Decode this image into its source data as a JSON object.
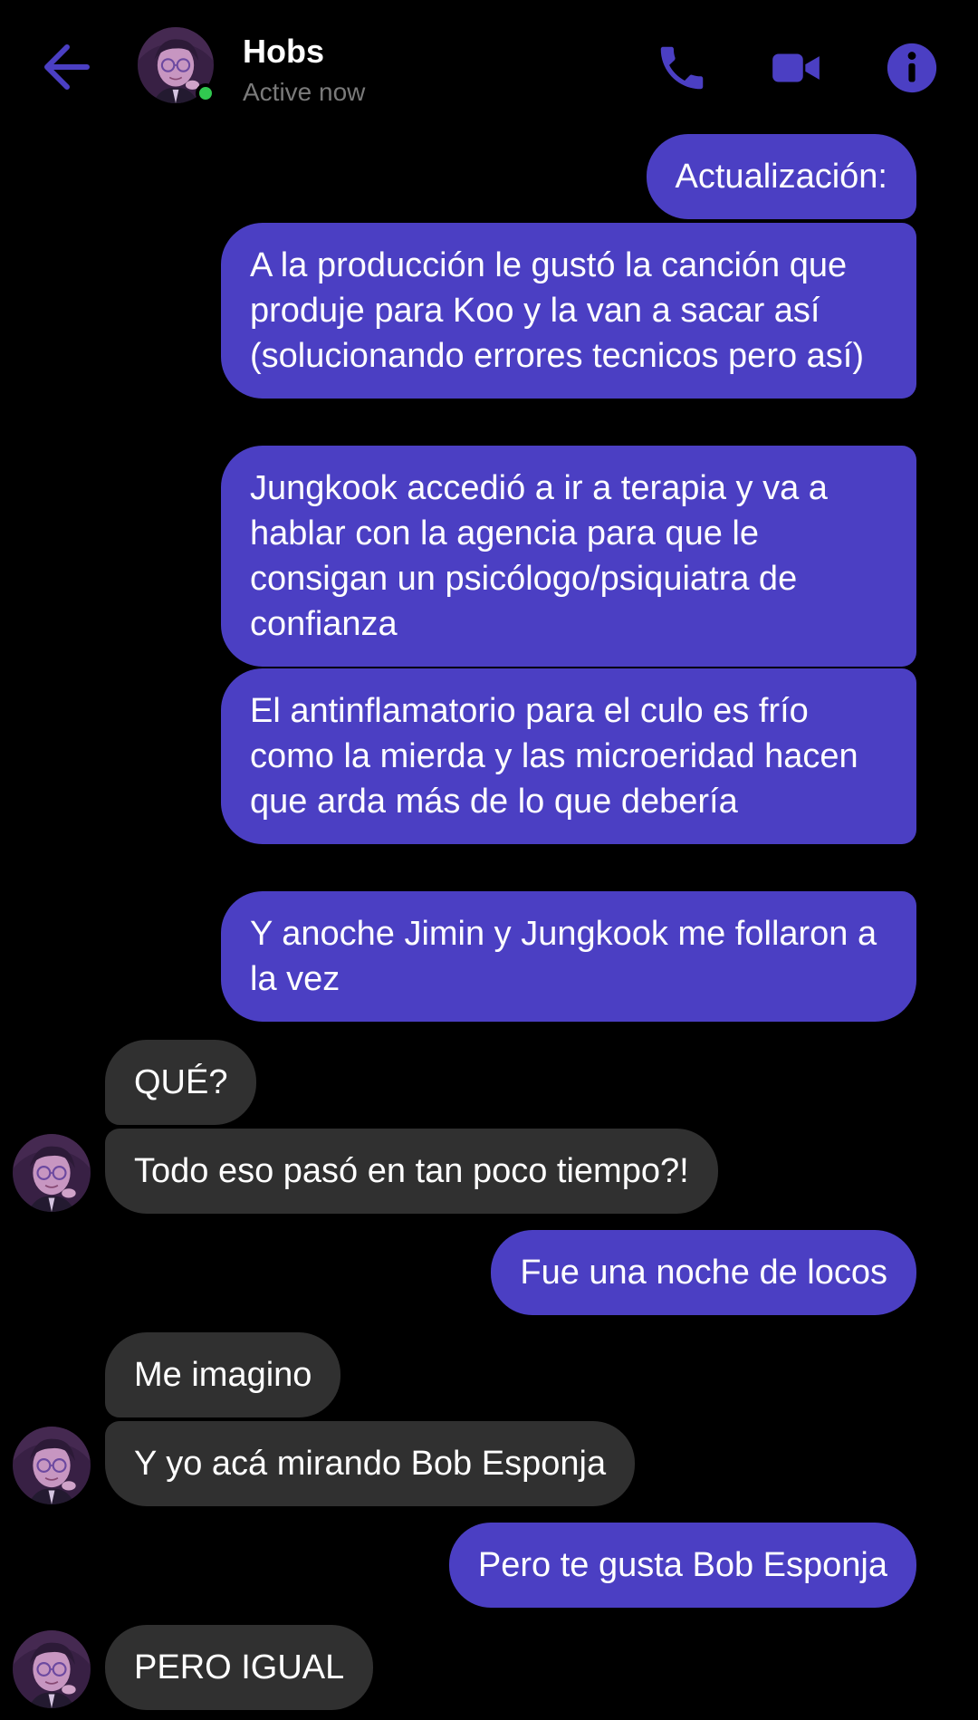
{
  "header": {
    "name": "Hobs",
    "status": "Active now",
    "icons": {
      "back": "arrow-left-icon",
      "phone": "phone-icon",
      "video": "video-camera-icon",
      "info": "info-icon"
    }
  },
  "colors": {
    "accent": "#4b3fc3",
    "background": "#000000",
    "received_bubble": "#303030",
    "online": "#31c950",
    "status_text": "#7a7a7a"
  },
  "messages": [
    {
      "from": "me",
      "text": "Actualización:"
    },
    {
      "from": "me",
      "text": "A la producción le gustó la canción que produje para Koo y la van a sacar así (solucionando errores tecnicos pero así)"
    },
    {
      "from": "me",
      "text": "Jungkook accedió a ir a terapia y va a hablar con la agencia para que le consigan un psicólogo/psiquiatra de confianza"
    },
    {
      "from": "me",
      "text": "El antinflamatorio para el culo es frío como la mierda y las microeridad hacen que arda más de lo que debería"
    },
    {
      "from": "me",
      "text": "Y anoche Jimin y Jungkook me follaron a la vez"
    },
    {
      "from": "them",
      "text": "QUÉ?"
    },
    {
      "from": "them",
      "text": "Todo eso pasó en tan poco tiempo?!"
    },
    {
      "from": "me",
      "text": "Fue una noche de locos"
    },
    {
      "from": "them",
      "text": "Me imagino"
    },
    {
      "from": "them",
      "text": "Y yo acá mirando Bob Esponja"
    },
    {
      "from": "me",
      "text": "Pero te gusta Bob Esponja"
    },
    {
      "from": "them",
      "text": "PERO IGUAL"
    }
  ]
}
